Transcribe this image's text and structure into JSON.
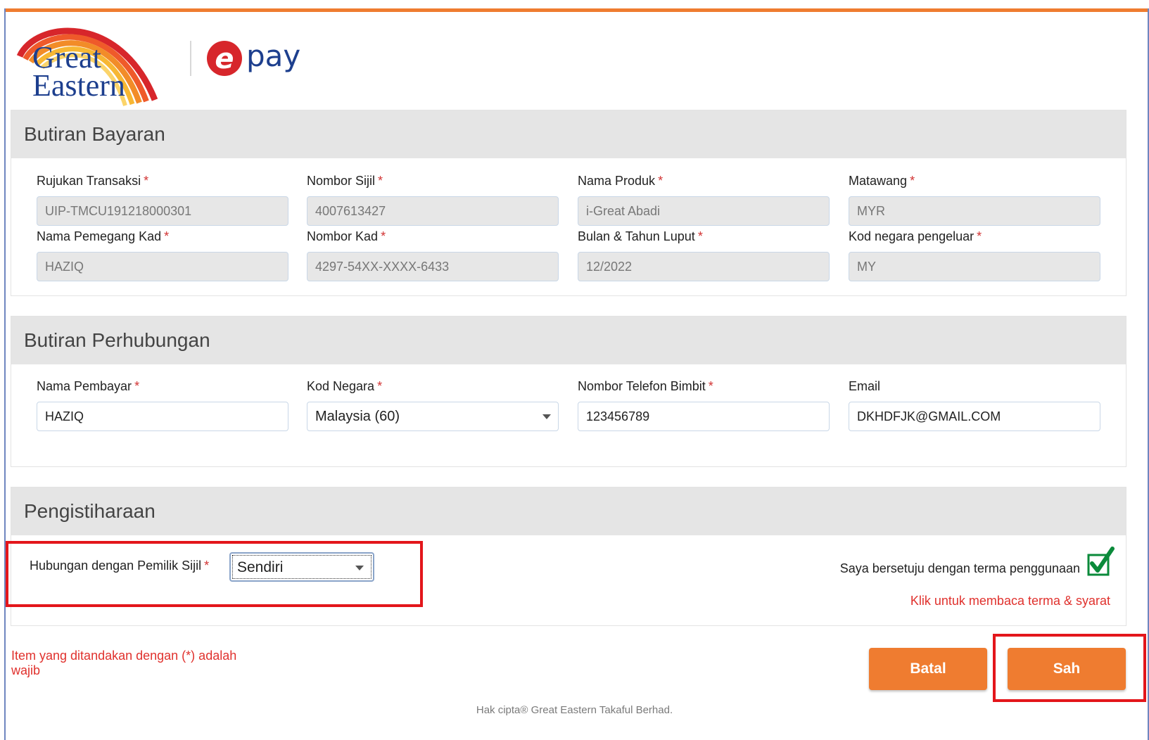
{
  "brand": {
    "logo_line1": "Great",
    "logo_line2": "Eastern",
    "epay_mark": "e",
    "epay_text": "pay",
    "colors": {
      "accent": "#ef7c30",
      "brand_blue": "#1d3f8e",
      "epay_red": "#d7262b",
      "required": "#d23333"
    }
  },
  "payment_details": {
    "title": "Butiran Bayaran",
    "fields": [
      {
        "label": "Rujukan Transaksi",
        "value": "UIP-TMCU191218000301"
      },
      {
        "label": "Nombor Sijil",
        "value": "4007613427"
      },
      {
        "label": "Nama Produk",
        "value": "i-Great Abadi"
      },
      {
        "label": "Matawang",
        "value": "MYR"
      },
      {
        "label": "Nama Pemegang Kad",
        "value": "HAZIQ"
      },
      {
        "label": "Nombor Kad",
        "value": "4297-54XX-XXXX-6433"
      },
      {
        "label": "Bulan & Tahun Luput",
        "value": "12/2022"
      },
      {
        "label": "Kod negara pengeluar",
        "value": "MY"
      }
    ]
  },
  "contact_details": {
    "title": "Butiran Perhubungan",
    "fields": [
      {
        "label": "Nama Pembayar",
        "value": "HAZIQ"
      },
      {
        "label": "Kod Negara",
        "value": "Malaysia (60)"
      },
      {
        "label": "Nombor Telefon Bimbit",
        "value": "123456789"
      },
      {
        "label": "Email",
        "value": "DKHDFJK@GMAIL.COM"
      }
    ]
  },
  "declaration": {
    "title": "Pengistiharaan",
    "relationship_label": "Hubungan dengan Pemilik Sijil",
    "relationship_value": "Sendiri",
    "agree_text": "Saya bersetuju dengan terma penggunaan",
    "terms_link": "Klik untuk membaca terma & syarat"
  },
  "required_marker": "*",
  "mandatory_note": "Item yang ditandakan dengan (*) adalah wajib",
  "buttons": {
    "cancel": "Batal",
    "submit": "Sah"
  },
  "footer": {
    "copyright": "Hak cipta® Great Eastern Takaful Berhad."
  }
}
